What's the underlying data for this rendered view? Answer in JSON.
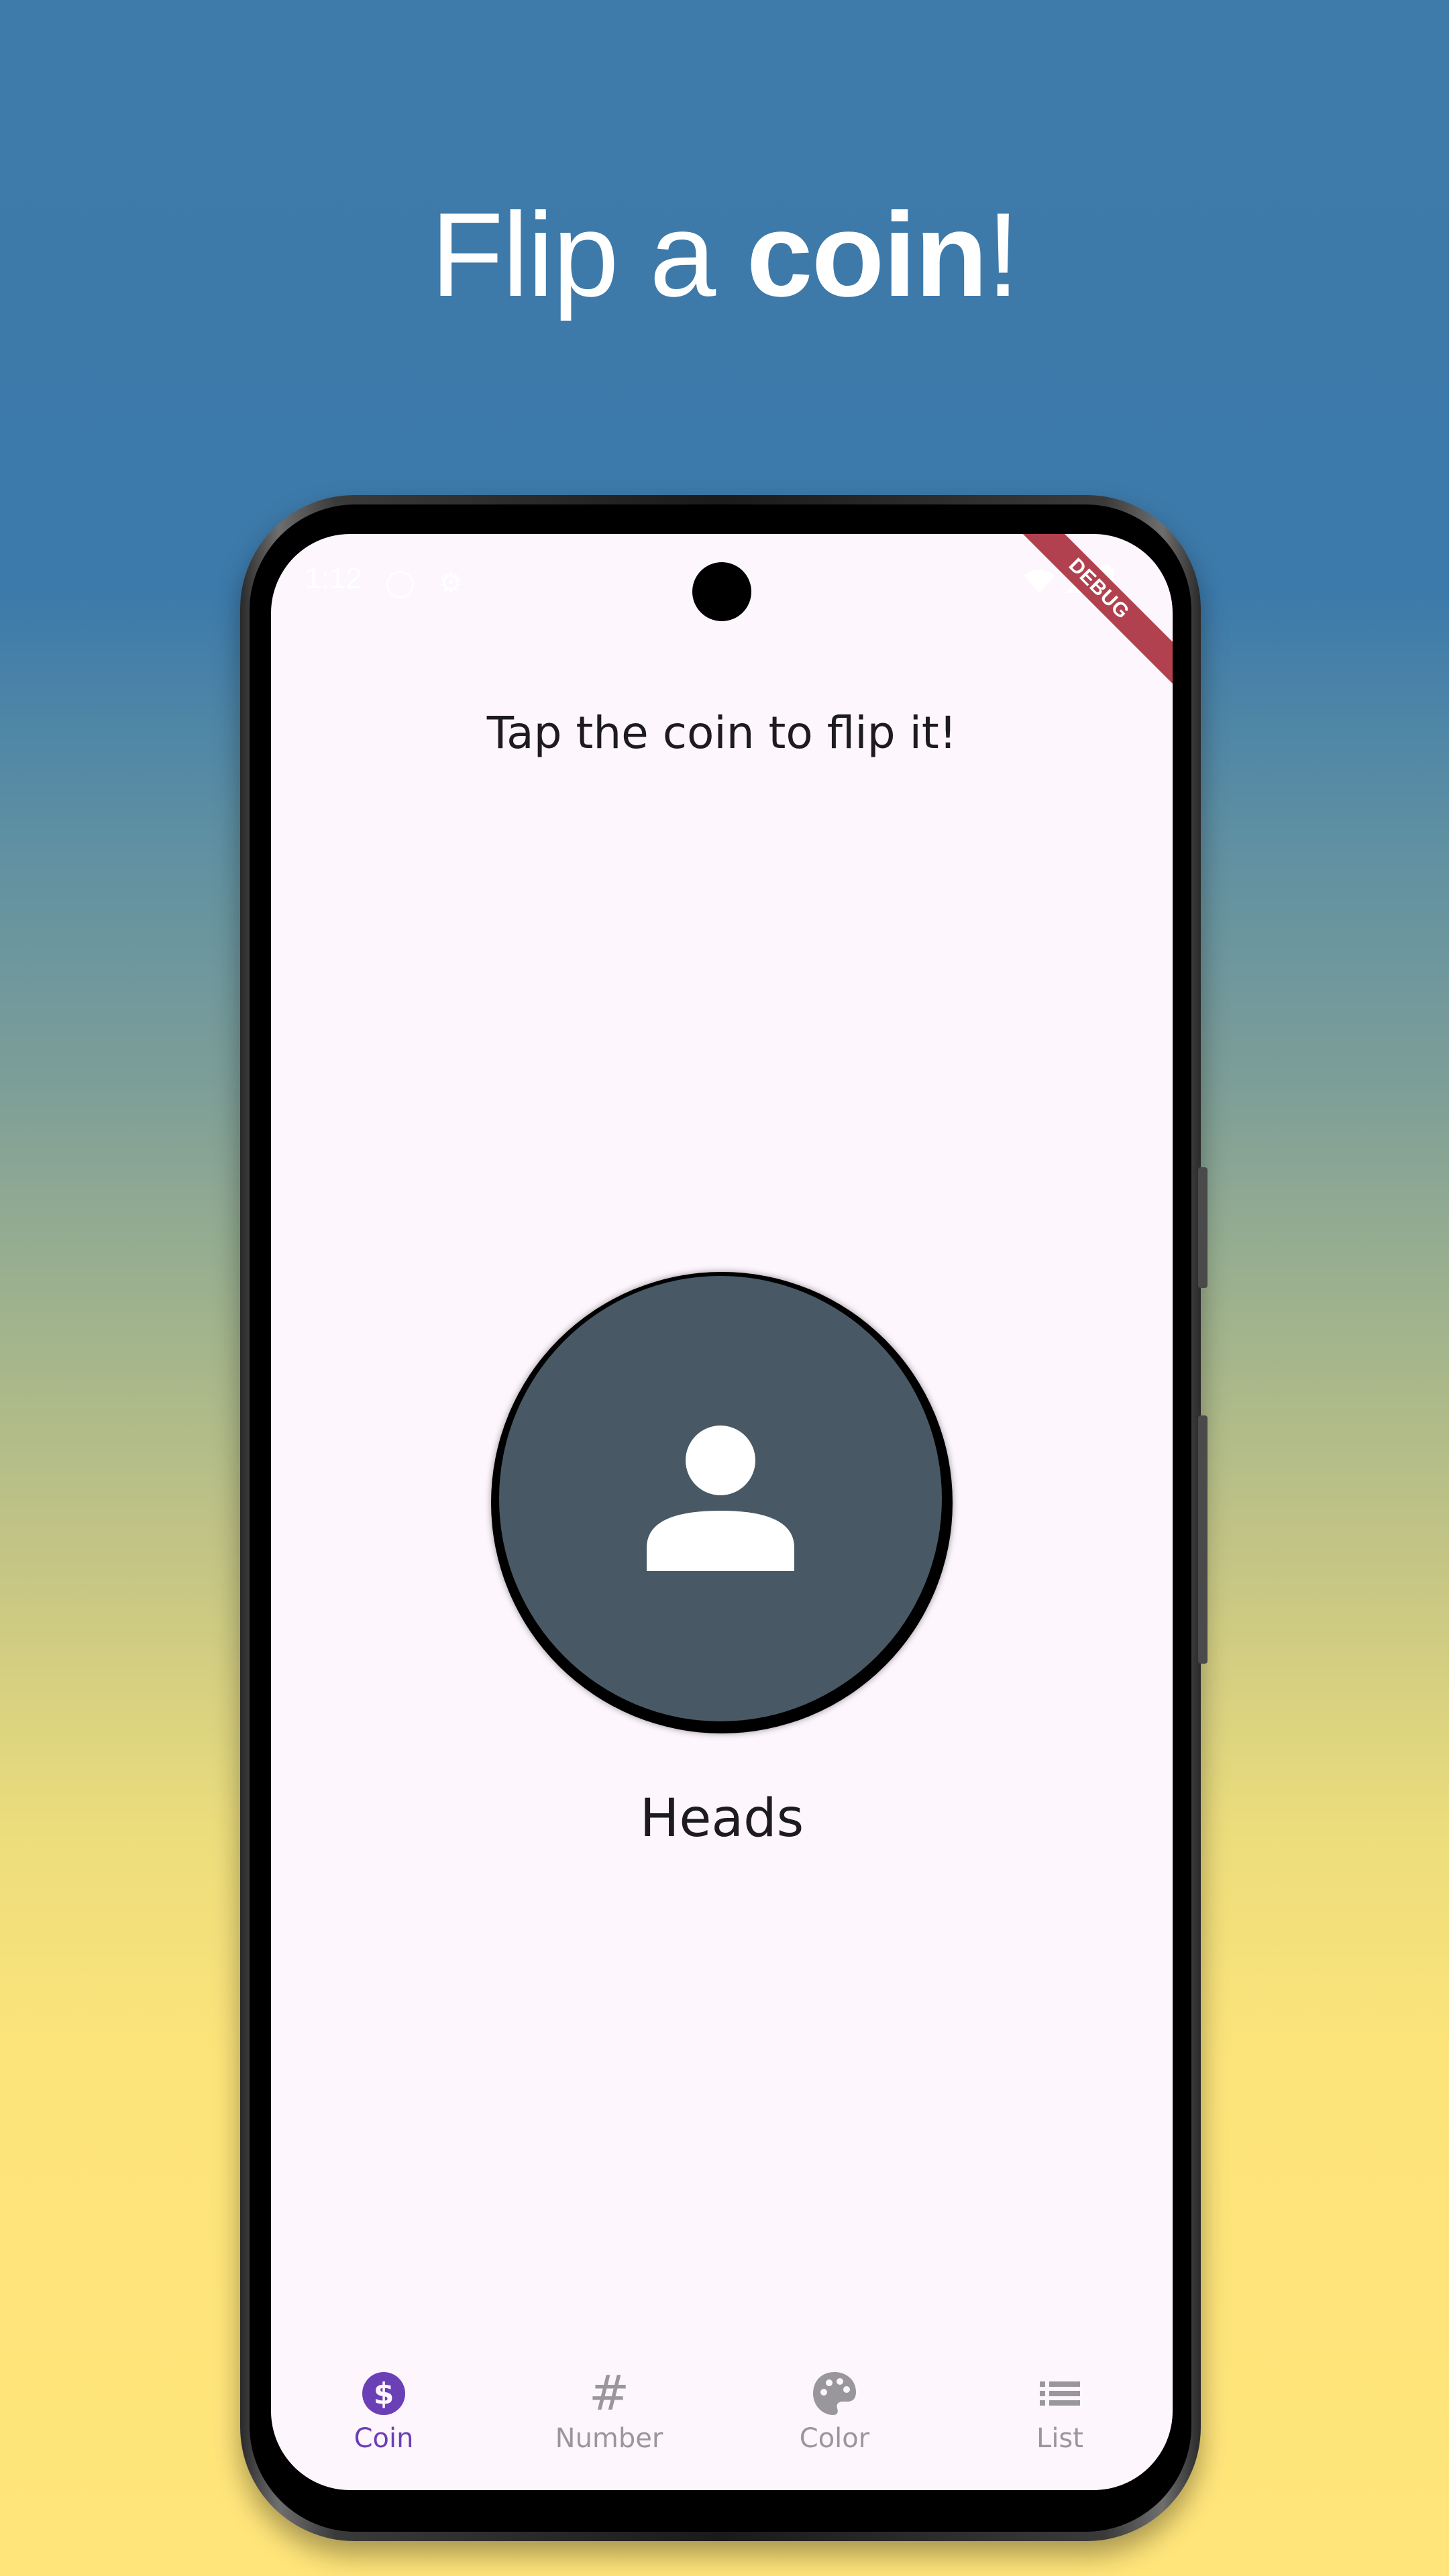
{
  "headline": {
    "prefix": "Flip a ",
    "strong": "coin",
    "suffix": "!"
  },
  "status_bar": {
    "time": "1:12"
  },
  "debug_banner": "DEBUG",
  "main": {
    "prompt": "Tap the coin to flip it!",
    "coin_icon": "person-icon",
    "result": "Heads"
  },
  "bottom_nav": {
    "items": [
      {
        "label": "Coin",
        "icon": "dollar-circle-icon",
        "active": true
      },
      {
        "label": "Number",
        "icon": "hash-icon",
        "active": false
      },
      {
        "label": "Color",
        "icon": "palette-icon",
        "active": false
      },
      {
        "label": "List",
        "icon": "list-icon",
        "active": false
      }
    ]
  },
  "colors": {
    "accent": "#6b3fb5",
    "inactive": "#9a979c",
    "coin_face": "#485965",
    "screen_bg": "#fdf6fd",
    "debug": "#b2414f"
  }
}
